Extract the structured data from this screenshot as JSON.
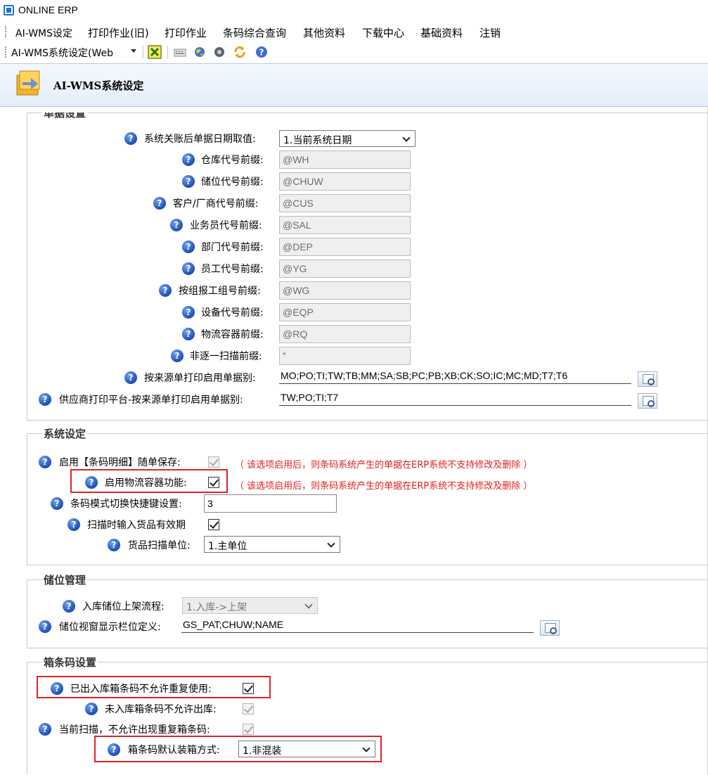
{
  "window": {
    "title": "ONLINE ERP"
  },
  "menu": [
    "AI-WMS设定",
    "打印作业(旧)",
    "打印作业",
    "条码综合查询",
    "其他资料",
    "下载中心",
    "基础资料",
    "注销"
  ],
  "toolbar": {
    "combo_value": "AI-WMS系统设定(Web",
    "icons": [
      "excel-icon",
      "keyboard-icon",
      "globe-icon",
      "disc-icon",
      "refresh-icon",
      "help-circle-icon"
    ]
  },
  "header": {
    "title": "AI-WMS系统设定"
  },
  "help_glyph": "?",
  "doc_section": {
    "title": "单据设置",
    "rows": [
      {
        "label": "系统关账后单据日期取值:",
        "value": "1.当前系统日期"
      },
      {
        "label": "仓库代号前缀:",
        "value": "@WH"
      },
      {
        "label": "储位代号前缀:",
        "value": "@CHUW"
      },
      {
        "label": "客户/厂商代号前缀:",
        "value": "@CUS"
      },
      {
        "label": "业务员代号前缀:",
        "value": "@SAL"
      },
      {
        "label": "部门代号前缀:",
        "value": "@DEP"
      },
      {
        "label": "员工代号前缀:",
        "value": "@YG"
      },
      {
        "label": "按组报工组号前缀:",
        "value": "@WG"
      },
      {
        "label": "设备代号前缀:",
        "value": "@EQP"
      },
      {
        "label": "物流容器前缀:",
        "value": "@RQ"
      },
      {
        "label": "非逐一扫描前缀:",
        "value": "*"
      },
      {
        "label": "按来源单打印启用单据别:",
        "value": "MO;PO;TI;TW;TB;MM;SA;SB;PC;PB;XB;CK;SO;IC;MC;MD;T7;T6"
      },
      {
        "label": "供应商打印平台-按来源单打印启用单据别:",
        "value": "TW;PO;TI;T7"
      }
    ]
  },
  "system_section": {
    "title": "系统设定",
    "barcode_detail_save": {
      "label": "启用【条码明细】随单保存:",
      "checked": true,
      "disabled": true
    },
    "logistics_container": {
      "label": "启用物流容器功能:",
      "checked": true
    },
    "note": "（ 该选项启用后，则条码系统产生的单据在ERP系统不支持修改及删除 ）",
    "shortcut": {
      "label": "条码模式切换快捷键设置:",
      "value": "3"
    },
    "expiry_scan": {
      "label": "扫描时输入货品有效期",
      "checked": true
    },
    "scan_unit": {
      "label": "货品扫描单位:",
      "value": "1.主单位"
    }
  },
  "location_section": {
    "title": "储位管理",
    "putaway_flow": {
      "label": "入库储位上架流程:",
      "value": "1.入库->上架"
    },
    "window_columns": {
      "label": "储位视窗显示栏位定义:",
      "value": "GS_PAT;CHUW;NAME"
    }
  },
  "box_section": {
    "title": "箱条码设置",
    "no_reuse": {
      "label": "已出入库箱条码不允许重复使用:",
      "checked": true
    },
    "not_in_no_out": {
      "label": "未入库箱条码不允许出库:",
      "checked": true
    },
    "no_dup_scan": {
      "label": "当前扫描，不允许出现重复箱条码:",
      "checked": true
    },
    "packing_mode": {
      "label": "箱条码默认装箱方式:",
      "value": "1.非混装"
    }
  },
  "colors": {
    "accent": "#1d4fb8",
    "note_red": "#e0201f",
    "highlight_box": "#e02424"
  }
}
